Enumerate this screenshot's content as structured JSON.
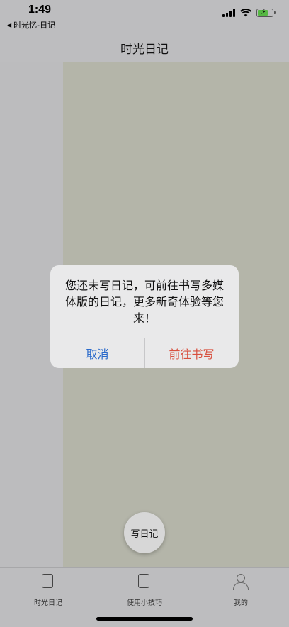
{
  "status_bar": {
    "time": "1:49",
    "back_app": "时光忆-日记"
  },
  "nav": {
    "title": "时光日记"
  },
  "alert": {
    "message": "您还未写日记，可前往书写多媒体版的日记，更多新奇体验等您来！",
    "cancel_label": "取消",
    "confirm_label": "前往书写",
    "cancel_color": "#2a6acb",
    "confirm_color": "#d8503f"
  },
  "fab": {
    "label": "写日记"
  },
  "tab_bar": {
    "items": [
      {
        "label": "时光日记",
        "icon": "notebook-icon"
      },
      {
        "label": "使用小技巧",
        "icon": "notebook-icon"
      },
      {
        "label": "我的",
        "icon": "person-icon"
      }
    ]
  },
  "icons": {
    "battery": "battery-charging-icon",
    "wifi": "wifi-icon",
    "signal": "cellular-signal-icon"
  }
}
